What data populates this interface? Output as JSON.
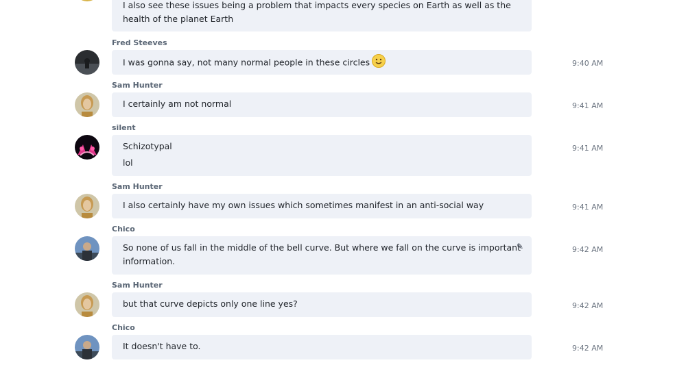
{
  "messages": [
    {
      "sender": "",
      "lines": [
        "I also see these issues being a problem that impacts every species on Earth as well as the",
        "health of the planet Earth"
      ],
      "time": ""
    },
    {
      "sender": "Fred Steeves",
      "lines": [
        "I was gonna say, not many normal people in these circles"
      ],
      "emoji": "smiley-emoji",
      "time": "9:40 AM",
      "avatar": "avatar-fred-steeves"
    },
    {
      "sender": "Sam Hunter",
      "lines": [
        "I certainly am not normal"
      ],
      "time": "9:41 AM",
      "avatar": "avatar-sam-hunter"
    },
    {
      "sender": "silent",
      "lines": [
        "Schizotypal",
        "lol"
      ],
      "time": "9:41 AM",
      "avatar": "avatar-silent"
    },
    {
      "sender": "Sam Hunter",
      "lines": [
        "I also certainly have my own issues which sometimes manifest in an anti-social way"
      ],
      "time": "9:41 AM",
      "avatar": "avatar-sam-hunter"
    },
    {
      "sender": "Chico",
      "lines": [
        "So none of us fall in the middle of the bell curve.  But where we fall on the curve is important",
        "information."
      ],
      "edited_icon": "edit-pencil-icon",
      "time": "9:42 AM",
      "avatar": "avatar-chico"
    },
    {
      "sender": "Sam Hunter",
      "lines": [
        "but that curve depicts only one line yes?"
      ],
      "time": "9:42 AM",
      "avatar": "avatar-sam-hunter"
    },
    {
      "sender": "Chico",
      "lines": [
        "It doesn't have to."
      ],
      "time": "9:42 AM",
      "avatar": "avatar-chico"
    }
  ],
  "colors": {
    "bubble_bg": "#eef1f7",
    "sender_text": "#5a6675",
    "message_text": "#1f2329",
    "time_text": "#6b7480"
  }
}
